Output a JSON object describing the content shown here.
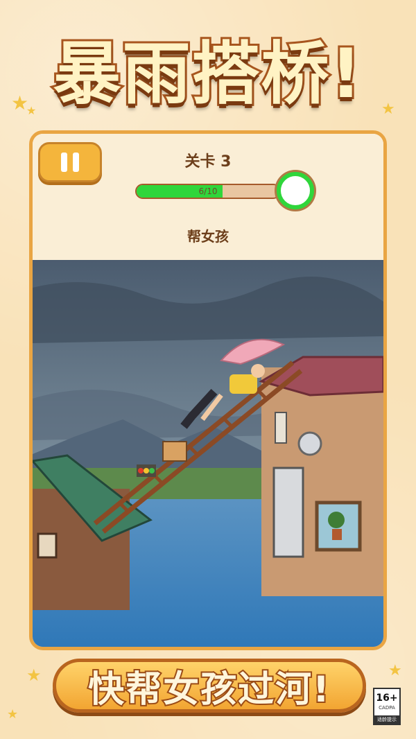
{
  "headline": "暴雨搭桥!",
  "game": {
    "level_label": "关卡 3",
    "progress": {
      "current": 6,
      "total": 10,
      "text": "6/10"
    },
    "hint": "帮女孩"
  },
  "cta_text": "快帮女孩过河!",
  "age_rating": {
    "value": "16+",
    "org": "CADPA",
    "note": "适龄提示"
  },
  "colors": {
    "accent": "#f4b53c",
    "progress_green": "#2fd63b",
    "text_brown": "#6d3f1b"
  },
  "icons": {
    "pause": "pause-icon",
    "star": "star-icon"
  }
}
